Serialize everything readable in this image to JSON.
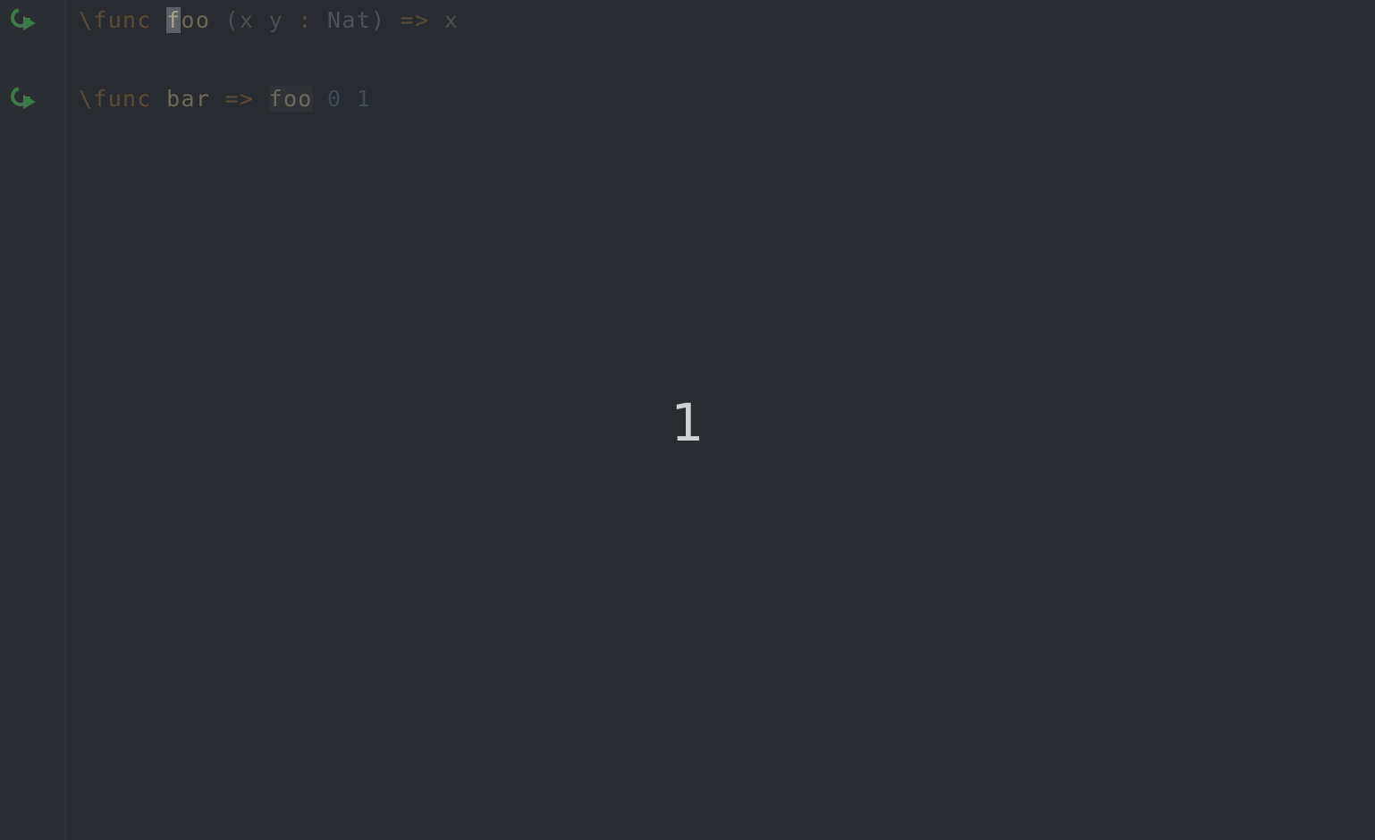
{
  "editor": {
    "lines": [
      {
        "tokens": [
          {
            "text": "\\func",
            "kind": "kw"
          },
          {
            "text": " ",
            "kind": "space"
          },
          {
            "text": "f",
            "kind": "caret"
          },
          {
            "text": "oo",
            "kind": "id"
          },
          {
            "text": " (x y ",
            "kind": "punct"
          },
          {
            "text": ":",
            "kind": "op"
          },
          {
            "text": " Nat) ",
            "kind": "type"
          },
          {
            "text": "=>",
            "kind": "op"
          },
          {
            "text": " x",
            "kind": "punct"
          }
        ]
      },
      {
        "tokens": [
          {
            "text": "\\func",
            "kind": "kw"
          },
          {
            "text": " ",
            "kind": "space"
          },
          {
            "text": "bar",
            "kind": "id"
          },
          {
            "text": " ",
            "kind": "space"
          },
          {
            "text": "=>",
            "kind": "op"
          },
          {
            "text": " ",
            "kind": "space"
          },
          {
            "text": "foo",
            "kind": "ref"
          },
          {
            "text": " 0 1",
            "kind": "num"
          }
        ]
      }
    ],
    "gutter_icons": [
      "run-icon",
      "run-icon"
    ]
  },
  "overlay": {
    "value": "1"
  },
  "colors": {
    "background": "#282c30",
    "gutter": "#2a2d31",
    "run_icon": "#3e7a4a"
  }
}
